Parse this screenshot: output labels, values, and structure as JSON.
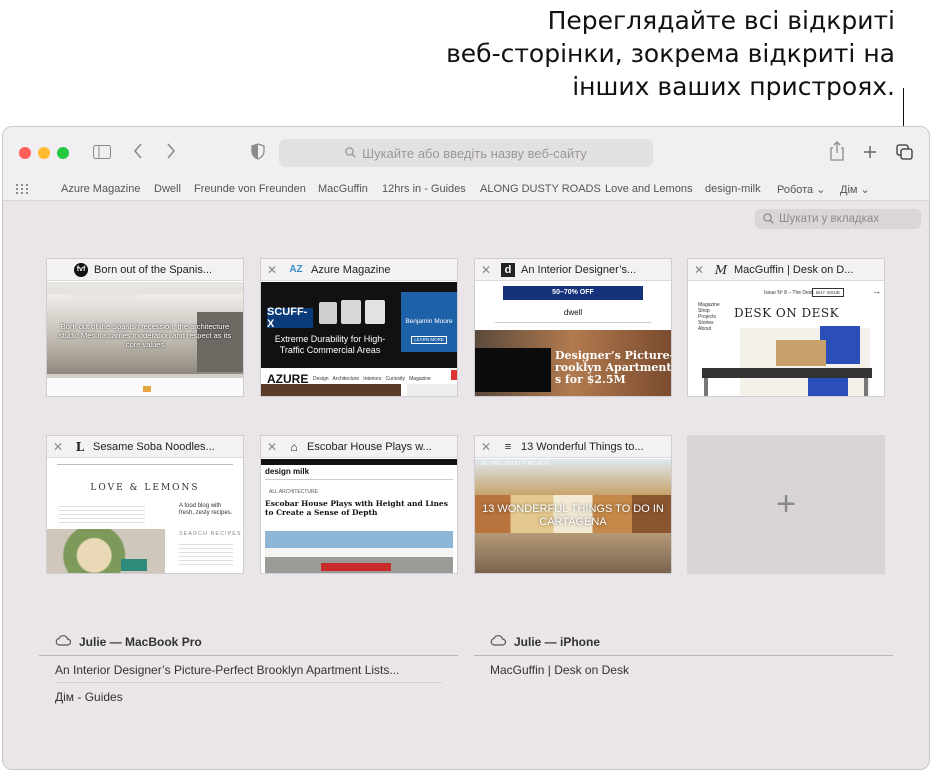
{
  "callout": {
    "line1": "Переглядайте всі відкриті",
    "line2": "веб-сторінки, зокрема відкриті на",
    "line3": "інших ваших пристроях."
  },
  "toolbar": {
    "search_placeholder": "Шукайте або введіть назву веб-сайту"
  },
  "favorites": [
    "Azure Magazine",
    "Dwell",
    "Freunde von Freunden",
    "MacGuffin",
    "12hrs in - Guides",
    "ALONG DUSTY ROADS",
    "Love and Lemons",
    "design-milk",
    "Робота ⌄",
    "Дім ⌄"
  ],
  "tab_search_placeholder": "Шукати у вкладках",
  "tabs": [
    {
      "title": "Born out of the Spanis...",
      "favicon": "fvf"
    },
    {
      "title": "Azure Magazine",
      "favicon": "AZ"
    },
    {
      "title": "An Interior Designer’s...",
      "favicon": "d"
    },
    {
      "title": "MacGuffin | Desk on D...",
      "favicon": "M"
    },
    {
      "title": "Sesame Soba Noodles...",
      "favicon": "L"
    },
    {
      "title": "Escobar House Plays w...",
      "favicon": "⌂"
    },
    {
      "title": "13 Wonderful Things to...",
      "favicon": "≡"
    }
  ],
  "thumbs": {
    "t1_caption": "Born out of the Spanish recession, the architecture studio Mesura carries moderation and respect as its core values",
    "t2_ad": "Extreme Durability for High-Traffic Commercial Areas",
    "t2_brand": "SCUFF-X",
    "t2_bm": "Benjamin Moore",
    "t2_learn": "LEARN MORE",
    "t2_logo": "AZURE",
    "t2_nav": "Design   Architecture   Interiors   Curiosity   Magazine",
    "t3_sale": "50–70% OFF",
    "t3_logo": "dwell",
    "t3_headline": "Designer’s Picture-\nrooklyn Apartment\ns for $2.5M",
    "t4_issue": "Issue Nº 8 – The Desk",
    "t4_buy": "BUY ISSUE",
    "t4_title": "DESK ON DESK",
    "t4_menu": "Magazine\nShop\nProjects\nStories\nAbout",
    "t5_logo": "LOVE & LEMONS",
    "t5_tag": "A food blog with fresh, zesty recipes.",
    "t5_search": "SEARCH RECIPES",
    "t6_logo": "design milk",
    "t6_section": "ALL ARCHITECTURE",
    "t6_headline": "Escobar House Plays with Height and Lines to Create a Sense of Depth",
    "t7_site": "ALONG DUSTY ROADS",
    "t7_headline": "13 WONDERFUL THINGS TO DO IN CARTAGENA"
  },
  "devices": [
    {
      "name": "Julie — MacBook Pro",
      "items": [
        "An Interior Designer’s Picture-Perfect Brooklyn Apartment Lists...",
        "Дім - Guides"
      ]
    },
    {
      "name": "Julie — iPhone",
      "items": [
        "MacGuffin | Desk on Desk"
      ]
    }
  ],
  "new_tab_symbol": "+"
}
